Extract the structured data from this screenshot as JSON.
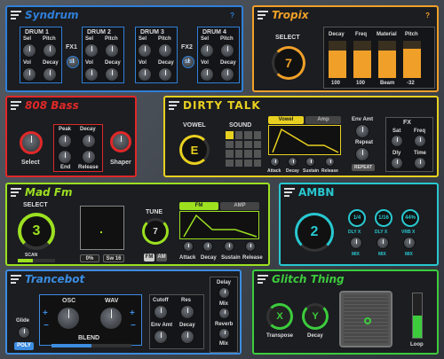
{
  "syndrum": {
    "title": "Syndrum",
    "help": "?",
    "accent": "#2f7fd8",
    "drums": [
      {
        "name": "DRUM 1",
        "labels": [
          "Sel",
          "Pitch",
          "Vol",
          "Decay"
        ]
      },
      {
        "name": "DRUM 2",
        "labels": [
          "Sel",
          "Pitch",
          "Vol",
          "Decay"
        ]
      },
      {
        "name": "DRUM 3",
        "labels": [
          "Sel",
          "Pitch",
          "Vol",
          "Decay"
        ]
      },
      {
        "name": "DRUM 4",
        "labels": [
          "Sel",
          "Pitch",
          "Vol",
          "Decay"
        ]
      }
    ],
    "fx": [
      "FX1",
      "FX2"
    ],
    "fx_buttons": [
      "S1",
      "S2"
    ]
  },
  "tropix": {
    "title": "Tropix",
    "help": "?",
    "accent": "#f0a028",
    "select_label": "SELECT",
    "select_value": "7",
    "bars": [
      {
        "label": "Decay",
        "value": "100",
        "level": 0.75
      },
      {
        "label": "Freq",
        "value": "100",
        "level": 0.75
      },
      {
        "label": "Material",
        "value": "Beam",
        "level": 0.75
      },
      {
        "label": "Pitch",
        "value": "-32",
        "level": 0.78
      }
    ]
  },
  "bass808": {
    "title": "808 Bass",
    "accent": "#e02828",
    "select_label": "Select",
    "knobs": [
      "Peak",
      "Decay",
      "End",
      "Release"
    ],
    "shaper_label": "Shaper"
  },
  "dirty_talk": {
    "title": "DIRTY TALK",
    "accent": "#e8d020",
    "vowel_label": "VOWEL",
    "vowel_value": "E",
    "sound_label": "SOUND",
    "tabs": [
      "Vowel",
      "Amp"
    ],
    "env_knobs": [
      "Attack",
      "Decay",
      "Sustain",
      "Release"
    ],
    "env_amt": "Env Amt",
    "repeat": "Repeat",
    "repeat_button": "REPEAT",
    "fx_label": "FX",
    "fx_knobs": [
      "Sat",
      "Freq",
      "Dly",
      "Time"
    ]
  },
  "mad_fm": {
    "title": "Mad Fm",
    "accent": "#9ce020",
    "select_label": "SELECT",
    "select_value": "3",
    "scan_label": "SCAN",
    "percent_value": "0%",
    "sw_value": "Sw 16",
    "tune_label": "TUNE",
    "tune_value": "7",
    "fm_button": "FM",
    "am_button": "AM",
    "tabs": [
      "FM",
      "AMP"
    ],
    "env_knobs": [
      "Attack",
      "Decay",
      "Sustain",
      "Release"
    ]
  },
  "ambn": {
    "title": "AMBN",
    "accent": "#28c8d0",
    "select_value": "2",
    "rates": [
      "1/4",
      "1/16",
      "44%"
    ],
    "dly_labels": [
      "DLY X",
      "DLY X",
      "VRB X"
    ],
    "mix_labels": [
      "MIX",
      "MIX",
      "MIX"
    ]
  },
  "trancebot": {
    "title": "Trancebot",
    "accent": "#3c8ce0",
    "glide_label": "Glide",
    "poly_button": "POLY",
    "osc_label": "OSC",
    "wav_label": "WAV",
    "blend_label": "BLEND",
    "knobs": [
      "Cutoff",
      "Res",
      "Env Amt",
      "Decay"
    ],
    "delay_label": "Delay",
    "mix_label_1": "Mix",
    "reverb_label": "Reverb",
    "mix_label_2": "Mix"
  },
  "glitch_thing": {
    "title": "Glitch Thing",
    "accent": "#3ccc3c",
    "transpose_label": "Transpose",
    "transpose_value": "X",
    "decay_label": "Decay",
    "decay_value": "Y",
    "loop_label": "Loop",
    "loop_level": 0.5
  }
}
